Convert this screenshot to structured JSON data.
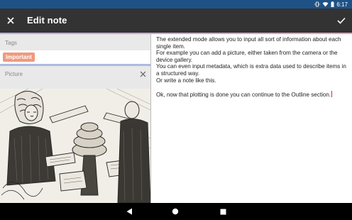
{
  "status_bar": {
    "time": "6:17",
    "icons": [
      "vibrate-icon",
      "wifi-icon",
      "battery-icon"
    ]
  },
  "app_bar": {
    "title": "Edit note",
    "close_icon": "close-icon",
    "confirm_icon": "check-icon"
  },
  "tags": {
    "header": "Tags",
    "items": [
      "Important"
    ],
    "chip_color": "#ef9a80"
  },
  "picture": {
    "header": "Picture",
    "close_icon": "close-icon"
  },
  "editor": {
    "paragraphs": [
      "The extended mode allows you to input all sort of information about each single item.",
      "For example you can add a picture, either taken from the camera or the device gallery.",
      "You can even input metadata, which is extra data used to describe items in a structured way.",
      "Or write a note like this."
    ],
    "final_line": "Ok, now that plotting is done you can continue to the Outline section."
  },
  "nav_bar": {
    "buttons": [
      "back-icon",
      "home-icon",
      "recents-icon"
    ]
  },
  "colors": {
    "status_bar": "#1e5287",
    "app_bar": "#333333",
    "caret": "#d81b60"
  }
}
